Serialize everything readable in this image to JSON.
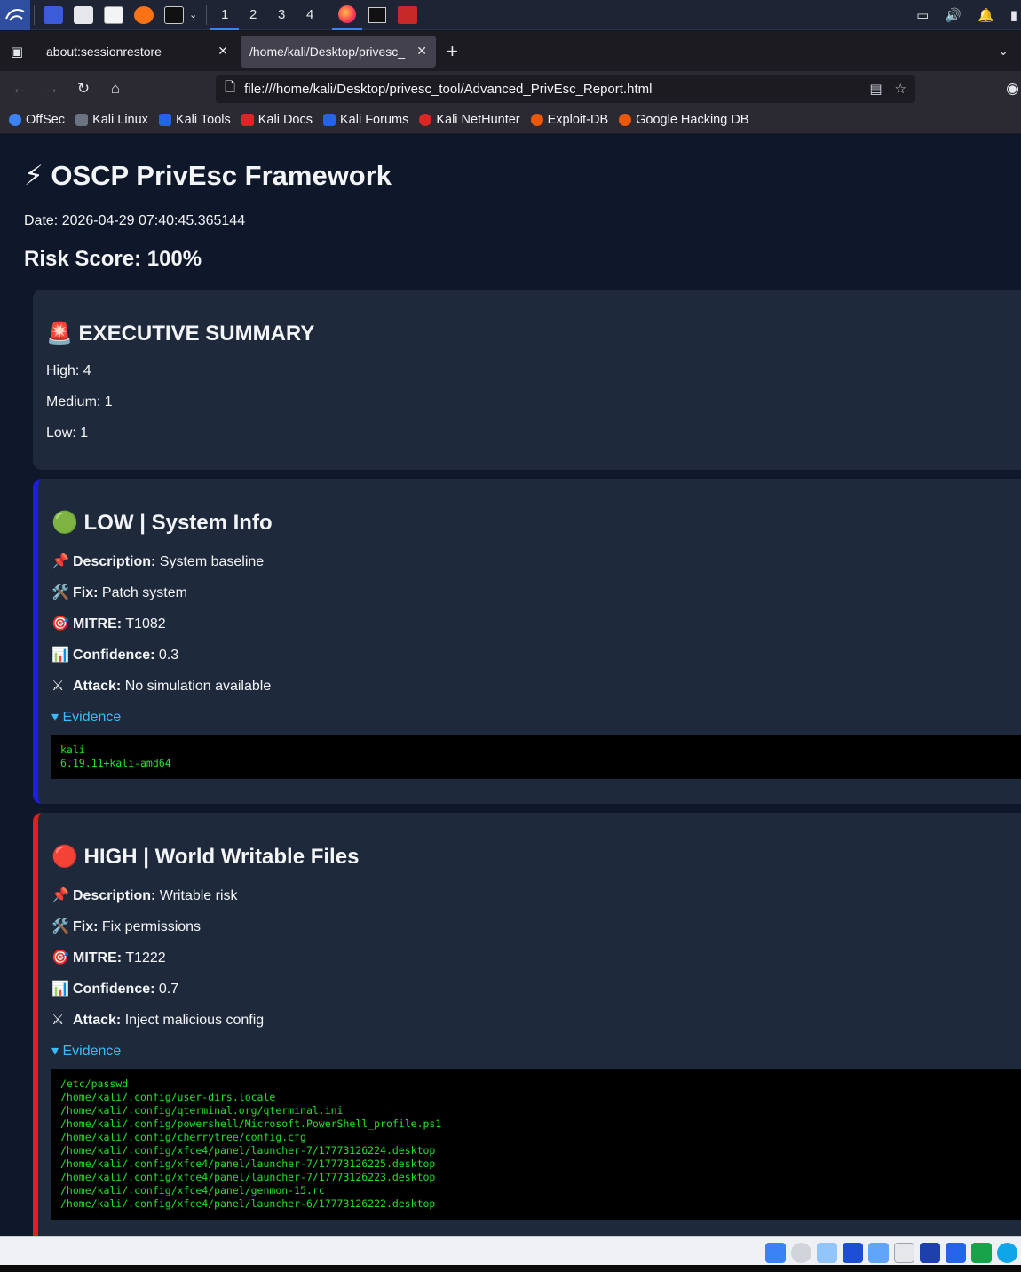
{
  "taskbar": {
    "workspaces": [
      "1",
      "2",
      "3",
      "4"
    ],
    "active_workspace": "1"
  },
  "browser": {
    "tabs": [
      {
        "title": "about:sessionrestore"
      },
      {
        "title": "/home/kali/Desktop/privesc_"
      }
    ],
    "url": "file:///home/kali/Desktop/privesc_tool/Advanced_PrivEsc_Report.html",
    "bookmarks": [
      "OffSec",
      "Kali Linux",
      "Kali Tools",
      "Kali Docs",
      "Kali Forums",
      "Kali NetHunter",
      "Exploit-DB",
      "Google Hacking DB"
    ]
  },
  "report": {
    "title": "⚡ OSCP PrivEsc Framework",
    "date": "Date: 2026-04-29 07:40:45.365144",
    "risk": "Risk Score: 100%",
    "summary": {
      "heading": "🚨 EXECUTIVE SUMMARY",
      "high": "High: 4",
      "medium": "Medium: 1",
      "low": "Low: 1"
    },
    "findings": [
      {
        "heading": "🟢 LOW | System Info",
        "labels": {
          "description": "Description:",
          "fix": "Fix:",
          "mitre": "MITRE:",
          "confidence": "Confidence:",
          "attack": "Attack:"
        },
        "description": "System baseline",
        "fix": "Patch system",
        "mitre": "T1082",
        "confidence": "0.3",
        "attack": "No simulation available",
        "evidence_label": "▾ Evidence",
        "evidence": "kali\n6.19.11+kali-amd64"
      },
      {
        "heading": "🔴 HIGH | World Writable Files",
        "labels": {
          "description": "Description:",
          "fix": "Fix:",
          "mitre": "MITRE:",
          "confidence": "Confidence:",
          "attack": "Attack:"
        },
        "description": "Writable risk",
        "fix": "Fix permissions",
        "mitre": "T1222",
        "confidence": "0.7",
        "attack": "Inject malicious config",
        "evidence_label": "▾ Evidence",
        "evidence": "/etc/passwd\n/home/kali/.config/user-dirs.locale\n/home/kali/.config/qterminal.org/qterminal.ini\n/home/kali/.config/powershell/Microsoft.PowerShell_profile.ps1\n/home/kali/.config/cherrytree/config.cfg\n/home/kali/.config/xfce4/panel/launcher-7/17773126224.desktop\n/home/kali/.config/xfce4/panel/launcher-7/17773126225.desktop\n/home/kali/.config/xfce4/panel/launcher-7/17773126223.desktop\n/home/kali/.config/xfce4/panel/genmon-15.rc\n/home/kali/.config/xfce4/panel/launcher-6/17773126222.desktop"
      }
    ]
  },
  "colors": {
    "page_bg": "#0f172a",
    "card_bg": "#1e293b",
    "low_border": "#1d1de6",
    "high_border": "#e11d1d",
    "evidence_link": "#38bdf8",
    "code_text": "#22e02a"
  }
}
